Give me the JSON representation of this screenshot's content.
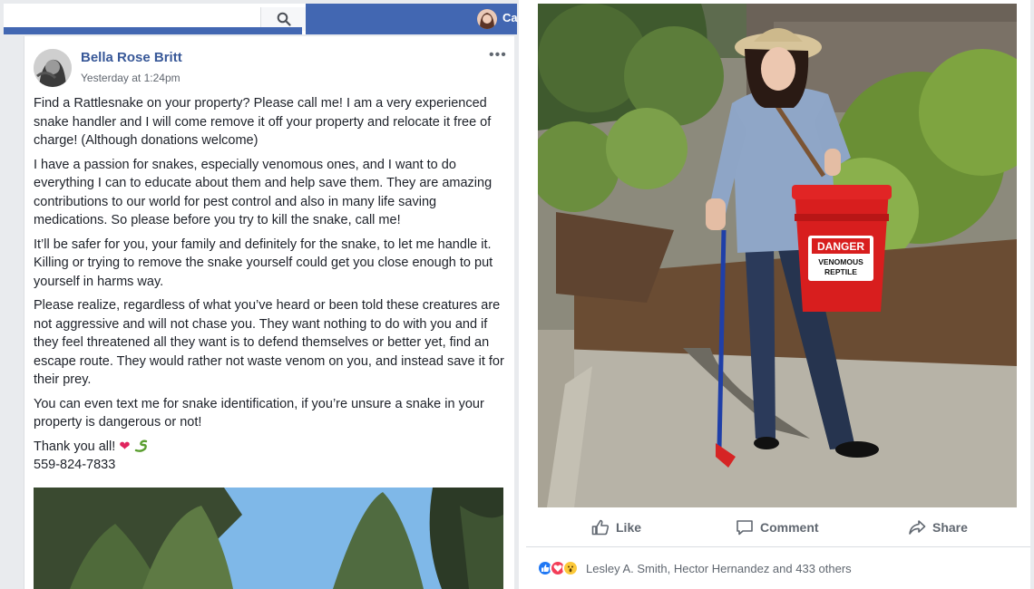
{
  "header": {
    "user_short": "Ca",
    "search_icon": "search-icon"
  },
  "post": {
    "author": "Bella Rose Britt",
    "timestamp": "Yesterday at 1:24pm",
    "more_icon": "•••",
    "paragraphs": [
      "Find a Rattlesnake on your property? Please call me! I am a very experienced snake handler and I will come remove it off your property and relocate it free of charge! (Although donations welcome)",
      "I have a passion for snakes, especially venomous ones, and I want to do everything I can to educate about them and help save them. They are amazing contributions to our world for pest control and also in many life saving medications. So please before you try to kill the snake, call me!",
      "It’ll be safer for you, your family and definitely for the snake, to let me handle it. Killing or trying to remove the snake yourself could get you close enough to put yourself in harms way.",
      "Please realize, regardless of what you’ve heard or been told these creatures are not aggressive and will not chase you. They want nothing to do with you and if they feel threatened all they want is to defend themselves or better yet, find an escape route. They would rather not waste venom on you, and instead save it for their prey.",
      "You can even text me for snake identification, if you’re unsure a snake in your property is dangerous or not!"
    ],
    "thanks": "Thank you all!",
    "thanks_emojis": [
      "heart-emoji",
      "snake-emoji"
    ],
    "phone": "559-824-7833"
  },
  "photo_post": {
    "bucket_label_1": "DANGER",
    "bucket_label_2": "VENOMOUS",
    "bucket_label_3": "REPTILE",
    "actions": {
      "like": "Like",
      "comment": "Comment",
      "share": "Share"
    },
    "reactions_summary": "Lesley A. Smith, Hector Hernandez and 433 others",
    "reaction_icons": [
      "like-reaction-icon",
      "love-reaction-icon",
      "wow-reaction-icon"
    ]
  },
  "colors": {
    "facebook_blue": "#4267b2",
    "link_blue": "#385898",
    "action_gray": "#606770",
    "bucket_red": "#d81e1e"
  }
}
